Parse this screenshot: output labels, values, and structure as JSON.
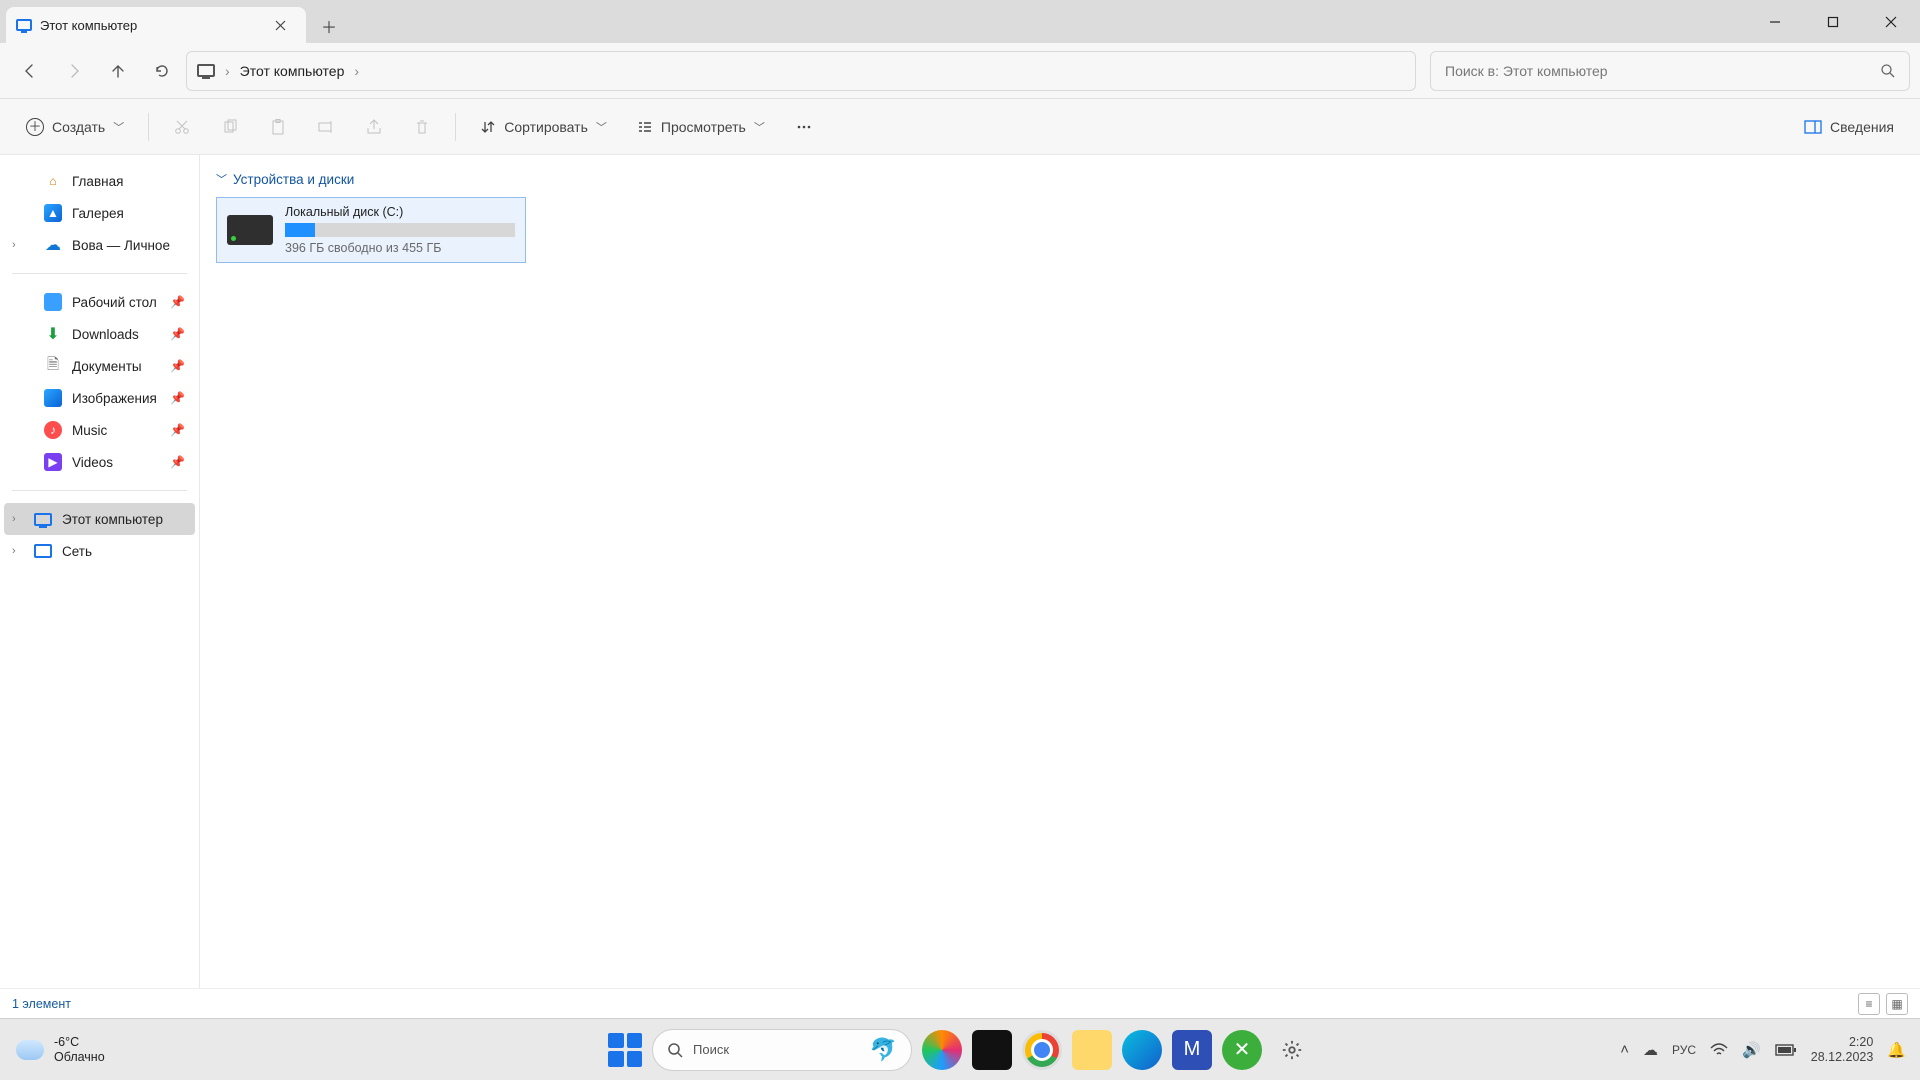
{
  "tab": {
    "title": "Этот компьютер"
  },
  "breadcrumb": {
    "current": "Этот компьютер"
  },
  "search": {
    "placeholder": "Поиск в: Этот компьютер"
  },
  "toolbar": {
    "create": "Создать",
    "sort": "Сортировать",
    "view": "Просмотреть",
    "details": "Сведения"
  },
  "sidebar": {
    "home": "Главная",
    "gallery": "Галерея",
    "onedrive": "Вова — Личное",
    "pinned": [
      {
        "label": "Рабочий стол"
      },
      {
        "label": "Downloads"
      },
      {
        "label": "Документы"
      },
      {
        "label": "Изображения"
      },
      {
        "label": "Music"
      },
      {
        "label": "Videos"
      }
    ],
    "this_pc": "Этот компьютер",
    "network": "Сеть"
  },
  "group": {
    "header": "Устройства и диски"
  },
  "drive": {
    "name": "Локальный диск (C:)",
    "subtitle": "396 ГБ свободно из 455 ГБ",
    "used_pct": 13
  },
  "status": {
    "items": "1 элемент"
  },
  "taskbar": {
    "temp": "-6°C",
    "weather": "Облачно",
    "search": "Поиск",
    "lang": "РУС",
    "time": "2:20",
    "date": "28.12.2023"
  }
}
